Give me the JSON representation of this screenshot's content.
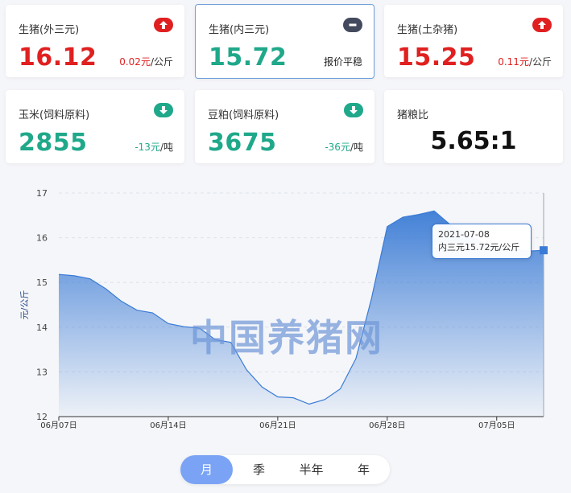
{
  "cards": [
    {
      "title": "生猪(外三元)",
      "value": "16.12",
      "change": "0.02元",
      "unit": "/公斤",
      "trend": "up"
    },
    {
      "title": "生猪(内三元)",
      "value": "15.72",
      "change": "报价平稳",
      "unit": "",
      "trend": "flat"
    },
    {
      "title": "生猪(土杂猪)",
      "value": "15.25",
      "change": "0.11元",
      "unit": "/公斤",
      "trend": "up"
    },
    {
      "title": "玉米(饲料原料)",
      "value": "2855",
      "change": "-13元",
      "unit": "/吨",
      "trend": "down"
    },
    {
      "title": "豆粕(饲料原料)",
      "value": "3675",
      "change": "-36元",
      "unit": "/吨",
      "trend": "down"
    },
    {
      "title": "猪粮比",
      "value": "5.65:1",
      "change": "",
      "unit": "",
      "trend": "none"
    }
  ],
  "colors": {
    "up": "#e02020",
    "down": "#1fa88a",
    "flat": "#444a5e",
    "line": "#3a7bd5"
  },
  "chart_data": {
    "type": "area",
    "ylabel": "元/公斤",
    "ylim": [
      12,
      17
    ],
    "yticks": [
      12,
      13,
      14,
      15,
      16,
      17
    ],
    "xticks": [
      "06月07日",
      "06月14日",
      "06月21日",
      "06月28日",
      "07月05日"
    ],
    "x": [
      "06-07",
      "06-08",
      "06-09",
      "06-10",
      "06-11",
      "06-12",
      "06-13",
      "06-14",
      "06-15",
      "06-16",
      "06-17",
      "06-18",
      "06-19",
      "06-20",
      "06-21",
      "06-22",
      "06-23",
      "06-24",
      "06-25",
      "06-26",
      "06-27",
      "06-28",
      "06-29",
      "06-30",
      "07-01",
      "07-02",
      "07-03",
      "07-04",
      "07-05",
      "07-06",
      "07-07",
      "07-08"
    ],
    "series": [
      {
        "values": [
          15.18,
          15.15,
          15.08,
          14.86,
          14.58,
          14.38,
          14.32,
          14.08,
          14.01,
          13.98,
          13.72,
          13.66,
          13.05,
          12.66,
          12.44,
          12.42,
          12.28,
          12.38,
          12.62,
          13.3,
          14.65,
          16.25,
          16.46,
          16.52,
          16.6,
          16.3,
          16.1,
          15.9,
          15.8,
          15.75,
          15.7,
          15.72
        ],
        "grid": true
      }
    ]
  },
  "tooltip": {
    "date": "2021-07-08",
    "text": "内三元15.72元/公斤"
  },
  "watermark": "中国养猪网",
  "range_tabs": [
    "月",
    "季",
    "半年",
    "年"
  ],
  "active_tab": 0
}
